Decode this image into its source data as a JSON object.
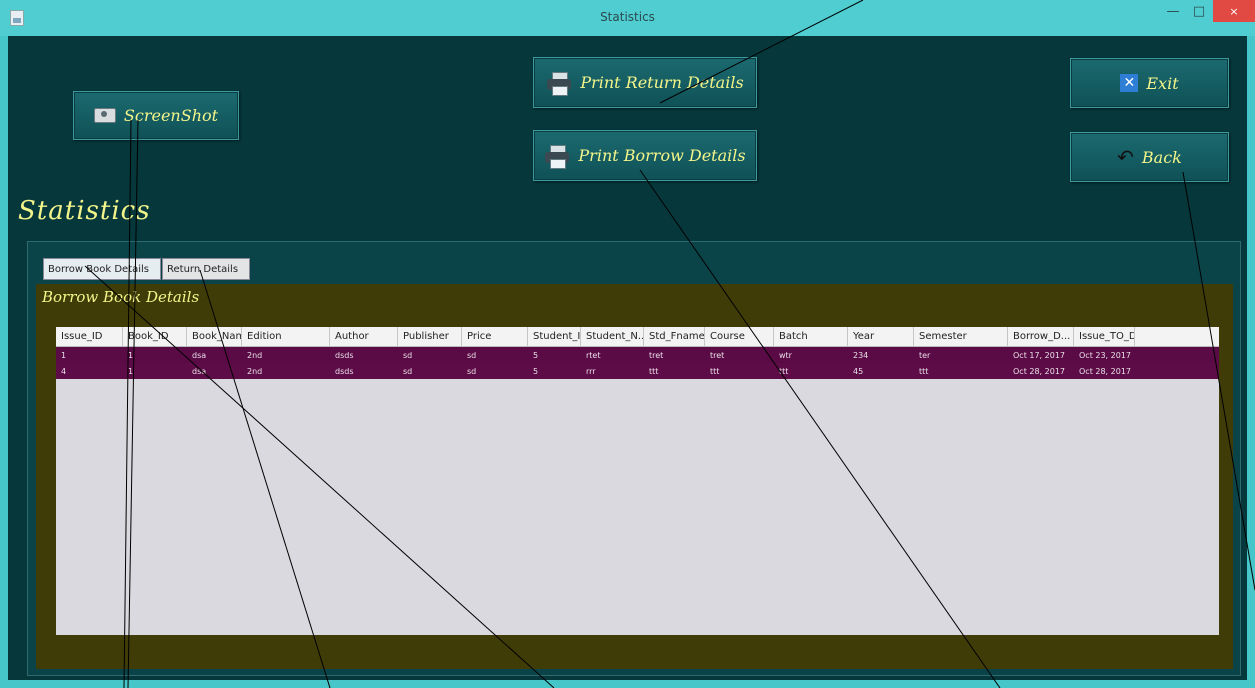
{
  "window": {
    "title": "Statistics",
    "minimize_glyph": "—",
    "maximize_glyph": "□",
    "close_glyph": "×"
  },
  "toolbar": {
    "screenshot_label": "ScreenShot",
    "print_return_label": "Print Return Details",
    "print_borrow_label": "Print Borrow Details",
    "exit_label": "Exit",
    "back_label": "Back"
  },
  "heading": "Statistics",
  "tabs": [
    {
      "label": "Borrow Book Details",
      "active": true
    },
    {
      "label": "Return Details",
      "active": false
    }
  ],
  "section_title": "Borrow Book Details",
  "table": {
    "columns": [
      "Issue_ID",
      "Book_ID",
      "Book_Name",
      "Edition",
      "Author",
      "Publisher",
      "Price",
      "Student_ID",
      "Student_N...",
      "Std_Fname",
      "Course",
      "Batch",
      "Year",
      "Semester",
      "Borrow_D...",
      "Issue_TO_D..."
    ],
    "rows": [
      [
        "1",
        "1",
        "dsa",
        "2nd",
        "dsds",
        "sd",
        "sd",
        "5",
        "rtet",
        "tret",
        "tret",
        "wtr",
        "234",
        "ter",
        "Oct 17, 2017",
        "Oct 23, 2017"
      ],
      [
        "4",
        "1",
        "dsa",
        "2nd",
        "dsds",
        "sd",
        "sd",
        "5",
        "rrr",
        "ttt",
        "ttt",
        "ttt",
        "45",
        "ttt",
        "Oct 28, 2017",
        "Oct 28, 2017"
      ]
    ]
  },
  "colors": {
    "window_frame": "#46c6c8",
    "client_bg": "#06373b",
    "accent_text": "#f3f58a",
    "tab_content_bg": "#403c08",
    "row_selected": "#5a0a44",
    "close_button": "#e04a42"
  }
}
